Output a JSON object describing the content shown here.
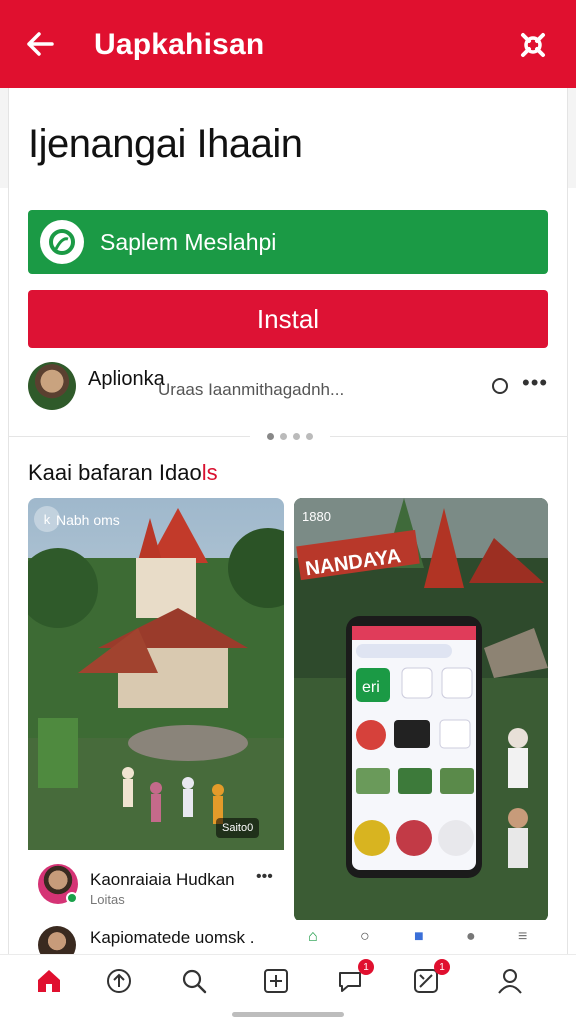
{
  "app_bar": {
    "title": "Uapkahisan",
    "back_icon": "arrow-left-icon",
    "settings_icon": "settings-icon",
    "color": "#e0102f"
  },
  "headline": "Ijenangai Ihaain",
  "green_button": {
    "label": "Saplem Meslahpi",
    "color": "#1b9a45"
  },
  "install_button": {
    "label": "Instal",
    "color": "#dd1234"
  },
  "developer": {
    "name": "Aplionka",
    "subtitle": "Uraas Iaanmithagadnh..."
  },
  "section": {
    "title_start": "Kaai bafaran Idao",
    "title_highlight": "ls"
  },
  "tile_left": {
    "label": "Nabh oms",
    "badge": "k",
    "duration": "Saito0"
  },
  "tile_right": {
    "label": "1880",
    "banner": "NANDAYA",
    "phone_app_label": "eri"
  },
  "post": {
    "name": "Kaonraiaia Hudkan",
    "subtitle": "Loitas"
  },
  "post2": {
    "name": "Kapiomatede uomsk ."
  },
  "bottom_nav": [
    {
      "name": "home",
      "icon": "home-icon",
      "active": true
    },
    {
      "name": "upload",
      "icon": "upload-icon"
    },
    {
      "name": "search",
      "icon": "search-icon"
    },
    {
      "name": "create",
      "icon": "plus-square-icon"
    },
    {
      "name": "messages",
      "icon": "chat-icon",
      "badge": "1"
    },
    {
      "name": "activity",
      "icon": "activity-icon",
      "badge": "1"
    },
    {
      "name": "profile",
      "icon": "person-icon"
    }
  ]
}
